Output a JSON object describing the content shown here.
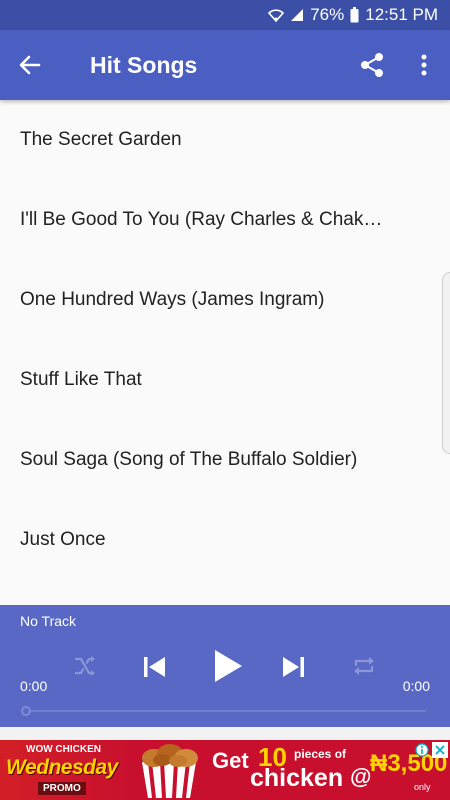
{
  "status_bar": {
    "battery": "76%",
    "time": "12:51 PM",
    "icons": [
      "wifi-icon",
      "signal-icon",
      "battery-icon"
    ]
  },
  "app_bar": {
    "title": "Hit Songs",
    "icons": [
      "back-arrow-icon",
      "share-icon",
      "overflow-menu-icon"
    ]
  },
  "songs": [
    "The Secret Garden",
    "I'll Be Good To You (Ray Charles & Chak…",
    "One Hundred Ways (James Ingram)",
    "Stuff Like That",
    "Soul Saga (Song of The Buffalo Soldier)",
    "Just Once"
  ],
  "player": {
    "track": "No Track",
    "elapsed": "0:00",
    "duration": "0:00",
    "progress": 0,
    "icons": [
      "shuffle-icon",
      "previous-icon",
      "play-icon",
      "next-icon",
      "repeat-icon"
    ]
  },
  "ad": {
    "left_top": "WOW CHICKEN",
    "left_main": "Wednesday",
    "left_bottom": "PROMO",
    "get": "Get",
    "ten": "10",
    "pieces": "pieces of",
    "chicken": "chicken",
    "at": "@",
    "price": "₦3,500",
    "only": "only"
  },
  "colors": {
    "status_bar": "#3b4fa6",
    "app_bar": "#4a5fc1",
    "player": "#5868c4",
    "ad_red": "#c8102e",
    "ad_yellow": "#ffd400"
  }
}
